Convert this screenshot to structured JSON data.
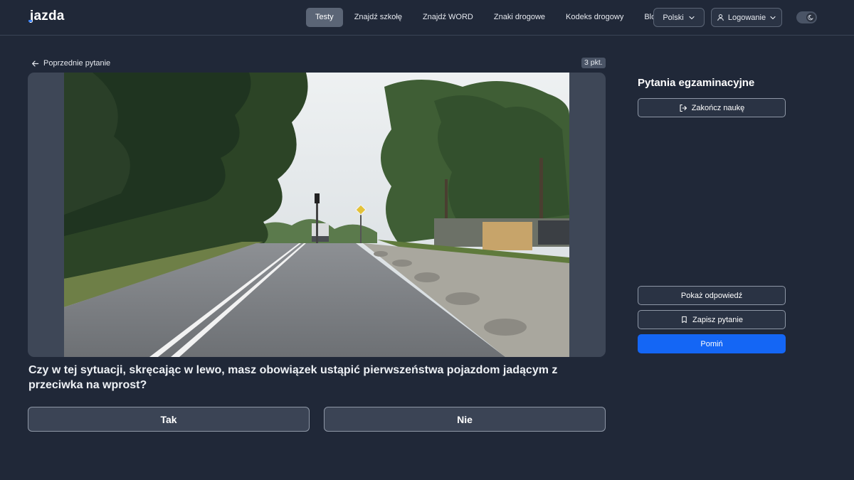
{
  "header": {
    "logo": "jazda",
    "nav": [
      {
        "label": "Testy",
        "active": true
      },
      {
        "label": "Znajdź szkołę",
        "active": false
      },
      {
        "label": "Znajdź WORD",
        "active": false
      },
      {
        "label": "Znaki drogowe",
        "active": false
      },
      {
        "label": "Kodeks drogowy",
        "active": false
      },
      {
        "label": "Blog",
        "active": false
      }
    ],
    "language": "Polski",
    "login": "Logowanie",
    "theme_icon": "moon-icon"
  },
  "question": {
    "prev_label": "Poprzednie pytanie",
    "points": "3 pkt.",
    "image_icon": "road-scene-photo",
    "text": "Czy w tej sytuacji, skręcając w lewo, masz obowiązek ustąpić pierwszeństwa pojazdom jadącym z przeciwka na wprost?",
    "answers": {
      "yes": "Tak",
      "no": "Nie"
    }
  },
  "panel": {
    "title": "Pytania egzaminacyjne",
    "end_label": "Zakończ naukę",
    "show_answer_label": "Pokaż odpowiedź",
    "save_label": "Zapisz pytanie",
    "skip_label": "Pomiń"
  },
  "colors": {
    "background": "#202838",
    "accent": "#1466f5",
    "nav_active": "#5b6576"
  }
}
